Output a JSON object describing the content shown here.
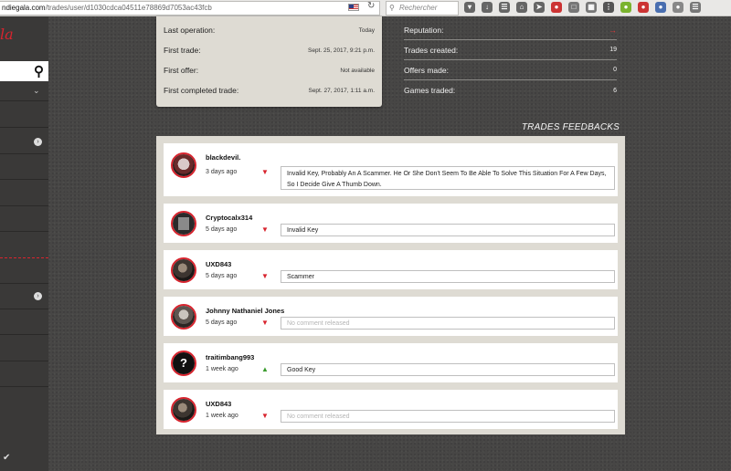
{
  "browser": {
    "url_host": "ndiegala.com",
    "url_path": "/trades/user/d1030cdca04511e78869d7053ac43fcb",
    "search_placeholder": "Rechercher"
  },
  "sidebar": {
    "logo_text": "la",
    "accent_color": "#d8242e"
  },
  "stats_left": [
    {
      "label": "Last operation:",
      "value": "Today"
    },
    {
      "label": "First trade:",
      "value": "Sept. 25, 2017, 9:21 p.m."
    },
    {
      "label": "First offer:",
      "value": "Not available"
    },
    {
      "label": "First completed trade:",
      "value": "Sept. 27, 2017, 1:11 a.m."
    }
  ],
  "stats_right": [
    {
      "label": "Reputation:",
      "value": "→"
    },
    {
      "label": "Trades created:",
      "value": "19"
    },
    {
      "label": "Offers made:",
      "value": "0"
    },
    {
      "label": "Games traded:",
      "value": "6"
    }
  ],
  "feedbacks_title": "TRADES FEEDBACKS",
  "feedbacks": [
    {
      "user": "blackdevil.",
      "time": "3 days ago",
      "rating": "negative",
      "avatar_icon": "skull-avatar",
      "comment": "Invalid Key, Probably An A Scammer. He Or She Don't Seem To Be Able To Solve This Situation For A Few Days, So I Decide Give A Thumb Down."
    },
    {
      "user": "Cryptocalx314",
      "time": "5 days ago",
      "rating": "negative",
      "avatar_icon": "poster-avatar",
      "comment": "Invalid Key"
    },
    {
      "user": "UXD843",
      "time": "5 days ago",
      "rating": "negative",
      "avatar_icon": "character-avatar",
      "comment": "Scammer"
    },
    {
      "user": "Johnny Nathaniel Jones",
      "time": "5 days ago",
      "rating": "negative",
      "avatar_icon": "robot-avatar",
      "comment": "No comment released"
    },
    {
      "user": "traitimbang993",
      "time": "1 week ago",
      "rating": "positive",
      "avatar_icon": "question-mark-avatar",
      "comment": "Good Key"
    },
    {
      "user": "UXD843",
      "time": "1 week ago",
      "rating": "negative",
      "avatar_icon": "character-avatar",
      "comment": "No comment released"
    }
  ]
}
